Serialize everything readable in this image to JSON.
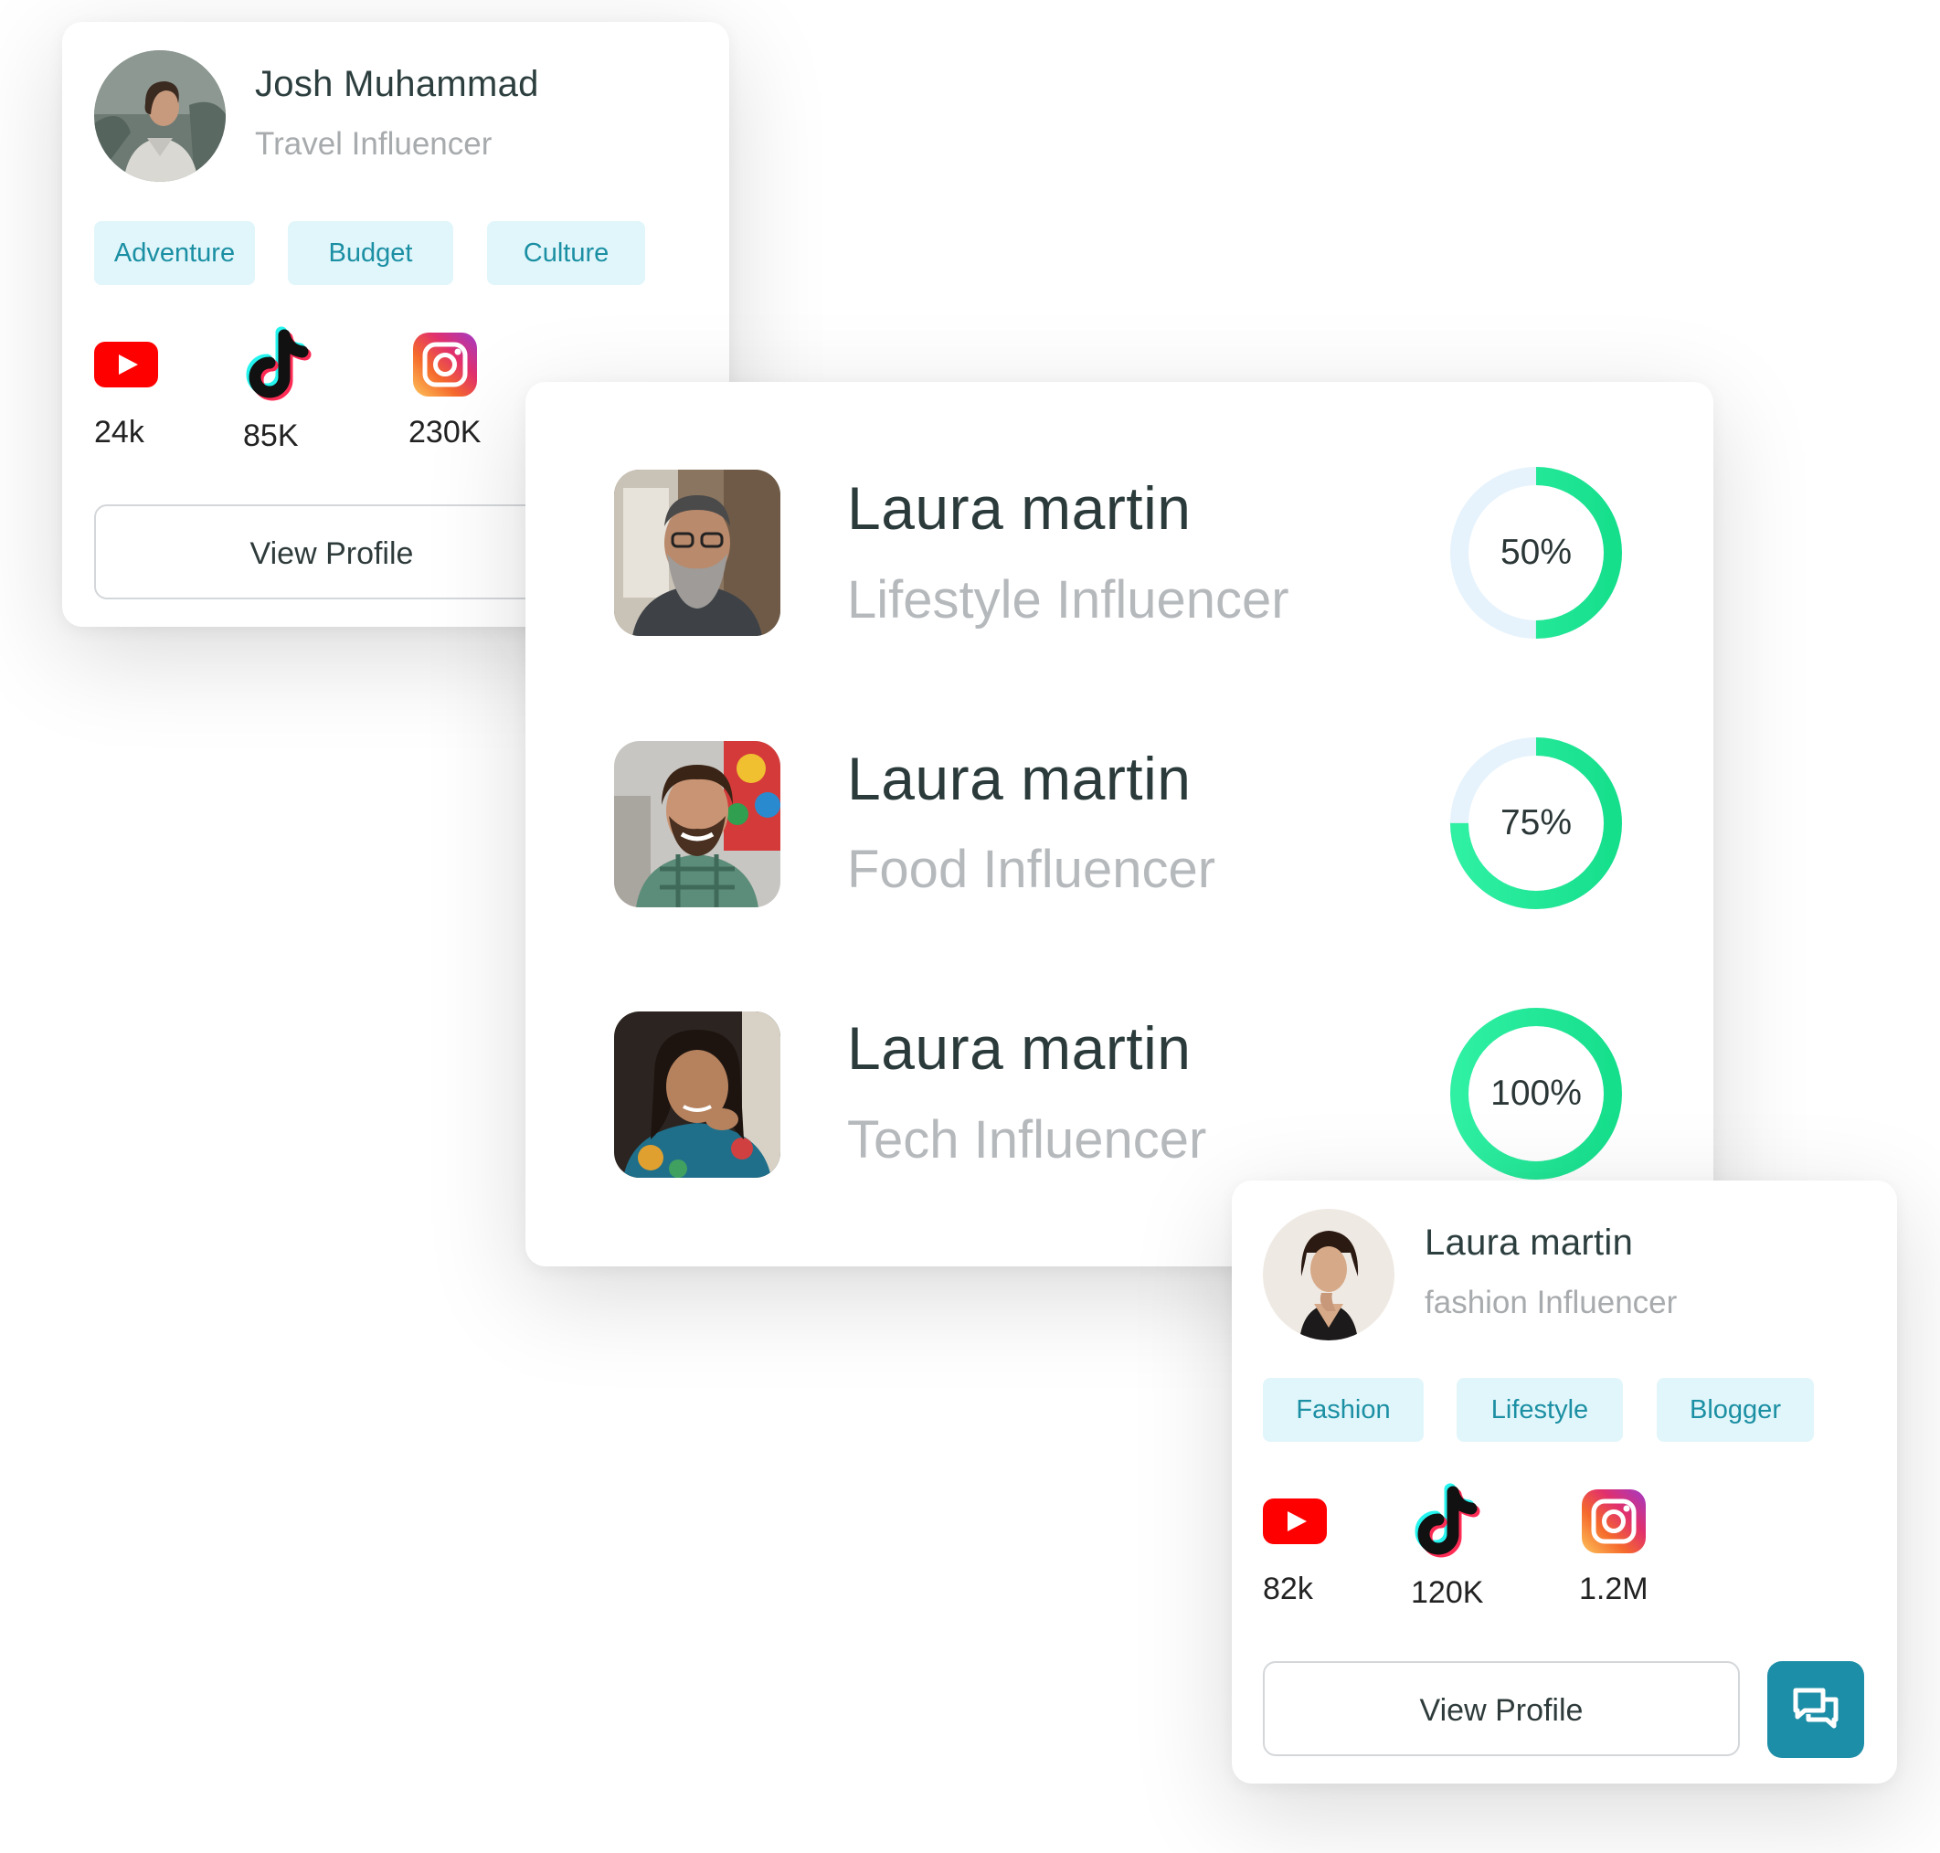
{
  "card_travel": {
    "name": "Josh Muhammad",
    "role": "Travel Influencer",
    "tags": [
      "Adventure",
      "Budget",
      "Culture"
    ],
    "socials": [
      {
        "icon": "youtube-icon",
        "count": "24k"
      },
      {
        "icon": "tiktok-icon",
        "count": "85K"
      },
      {
        "icon": "instagram-icon",
        "count": "230K"
      }
    ],
    "view_profile_label": "View Profile"
  },
  "influencer_list": {
    "items": [
      {
        "name": "Laura martin",
        "role": "Lifestyle Influencer",
        "progress_label": "50%",
        "progress": 0.5
      },
      {
        "name": "Laura martin",
        "role": "Food Influencer",
        "progress_label": "75%",
        "progress": 0.75
      },
      {
        "name": "Laura martin",
        "role": "Tech Influencer",
        "progress_label": "100%",
        "progress": 1.0
      }
    ]
  },
  "card_fashion": {
    "name": "Laura martin",
    "role": "fashion Influencer",
    "tags": [
      "Fashion",
      "Lifestyle",
      "Blogger"
    ],
    "socials": [
      {
        "icon": "youtube-icon",
        "count": "82k"
      },
      {
        "icon": "tiktok-icon",
        "count": "120K"
      },
      {
        "icon": "instagram-icon",
        "count": "1.2M"
      }
    ],
    "view_profile_label": "View Profile",
    "chat_icon": "chat-icon"
  },
  "colors": {
    "accent_teal": "#1d8ea7",
    "tag_bg": "#e1f6fb",
    "tag_text": "#1b8fa3",
    "ring_green": "#1ee59a",
    "ring_track": "#e6f3fc",
    "youtube_red": "#ff0000"
  }
}
